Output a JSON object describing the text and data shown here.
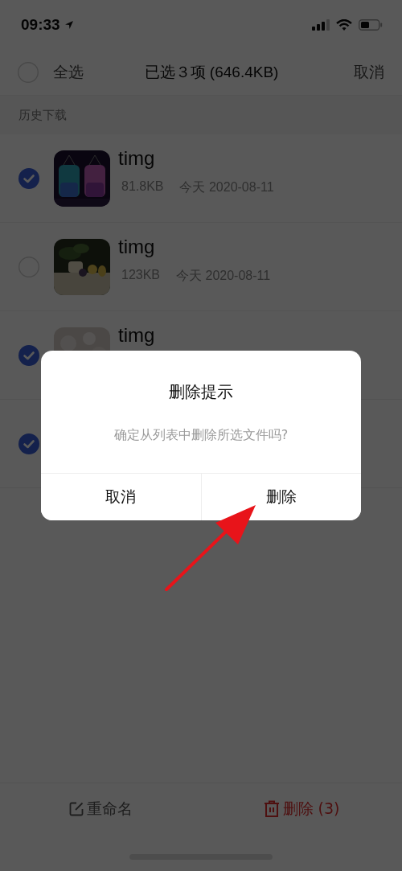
{
  "status_bar": {
    "time": "09:33"
  },
  "header": {
    "select_all": {
      "label": "全选",
      "checked": false
    },
    "title": "已选３项 (646.4KB)",
    "cancel": "取消"
  },
  "section_label": "历史下载",
  "items": [
    {
      "selected": true,
      "name": "timg",
      "size": "81.8KB",
      "date": "今天 2020-08-11"
    },
    {
      "selected": false,
      "name": "timg",
      "size": "123KB",
      "date": "今天 2020-08-11"
    },
    {
      "selected": true,
      "name": "timg"
    },
    {
      "selected": true
    }
  ],
  "bottom_bar": {
    "rename": "重命名",
    "delete": "删除 (3)"
  },
  "dialog": {
    "title": "删除提示",
    "message": "确定从列表中删除所选文件吗?",
    "buttons": [
      "取消",
      "删除"
    ]
  },
  "annotation": {
    "kind": "arrow"
  }
}
